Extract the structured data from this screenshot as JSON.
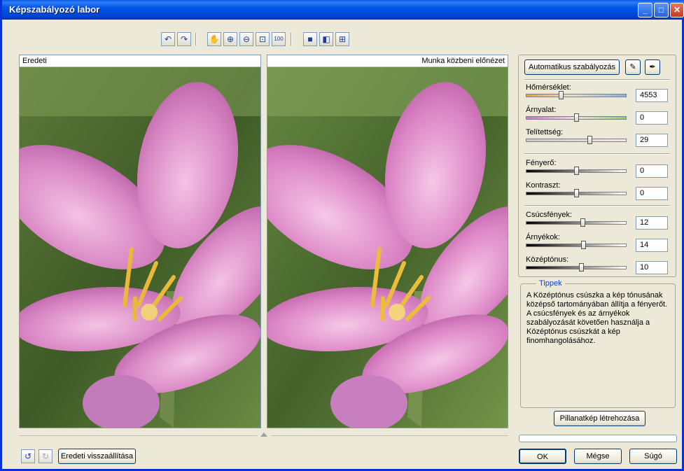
{
  "window": {
    "title": "Képszabályozó labor",
    "minimize": "_",
    "maximize": "□",
    "close": "✕"
  },
  "toolbar": {
    "icons": [
      "rotate-left-icon",
      "rotate-right-icon",
      "hand-icon",
      "zoom-in-icon",
      "zoom-out-icon",
      "fit-icon",
      "actual-size-icon",
      "single-view-icon",
      "split-view-icon",
      "quad-view-icon"
    ]
  },
  "panes": {
    "left_label": "Eredeti",
    "right_label": "Munka közbeni előnézet"
  },
  "panel": {
    "auto_button": "Automatikus szabályozás",
    "sliders": [
      {
        "label": "Hőmérséklet:",
        "value": "4553",
        "position": 0.35
      },
      {
        "label": "Árnyalat:",
        "value": "0",
        "position": 0.5
      },
      {
        "label": "Telítettség:",
        "value": "29",
        "position": 0.63
      },
      {
        "label": "Fényerő:",
        "value": "0",
        "position": 0.5
      },
      {
        "label": "Kontraszt:",
        "value": "0",
        "position": 0.5
      },
      {
        "label": "Csúcsfények:",
        "value": "12",
        "position": 0.56
      },
      {
        "label": "Árnyékok:",
        "value": "14",
        "position": 0.57
      },
      {
        "label": "Középtónus:",
        "value": "10",
        "position": 0.55
      }
    ]
  },
  "tips": {
    "title": "Tippek",
    "text": "A Középtónus csúszka a kép tónusának középső tartományában állítja a fényerőt. A csúcsfények és az árnyékok szabályozását követően használja a Középtónus csúszkát a kép finomhangolásához.",
    "snapshot_button": "Pillanatkép létrehozása"
  },
  "bottom": {
    "reset_button": "Eredeti visszaállítása",
    "ok": "OK",
    "cancel": "Mégse",
    "help": "Súgó"
  }
}
